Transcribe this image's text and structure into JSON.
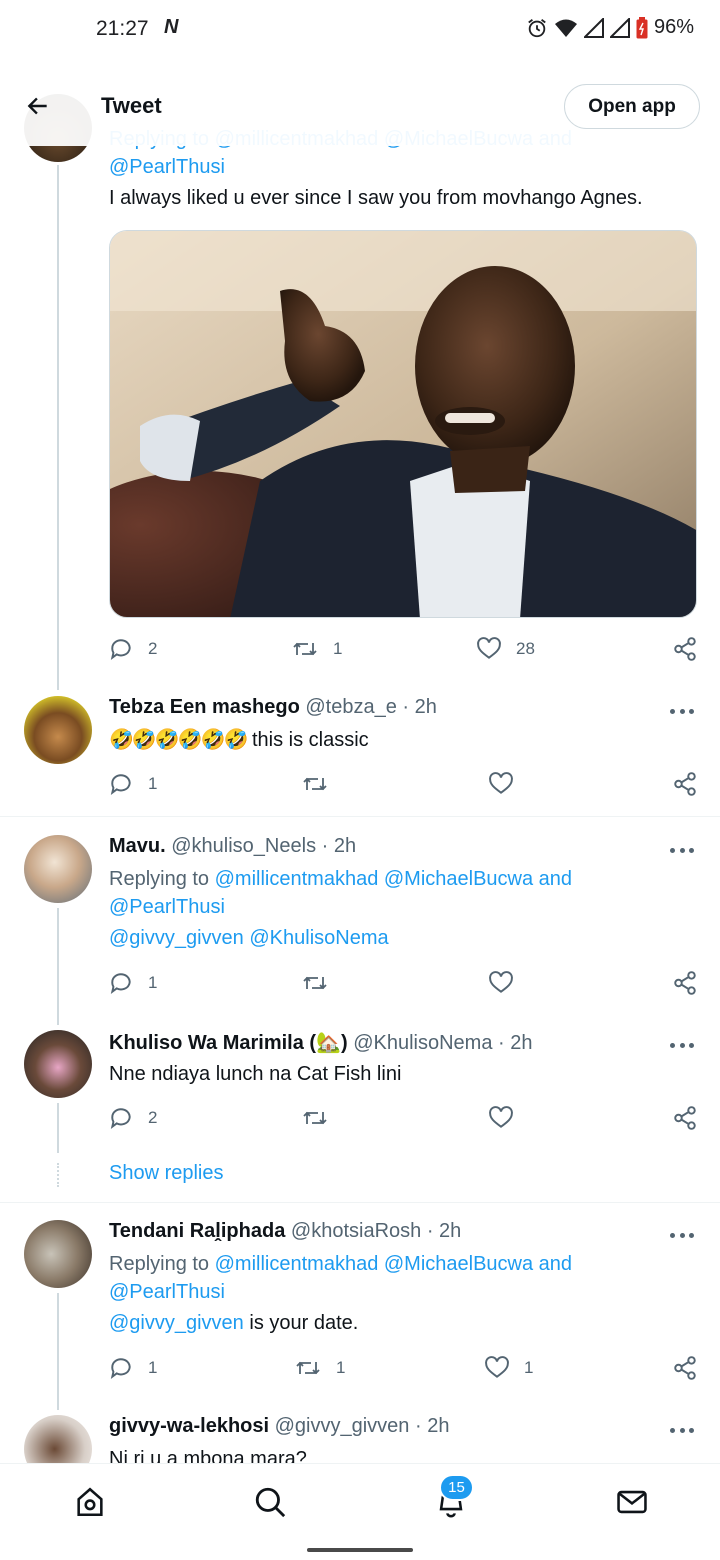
{
  "status_bar": {
    "time": "21:27",
    "net_label": "N",
    "battery": "96%"
  },
  "header": {
    "title": "Tweet",
    "open_app": "Open app"
  },
  "top_tweet": {
    "replying_partial": "Replying to @millicentmakhad @MichaelBucwa and",
    "mention_line": "@PearlThusi",
    "text": "I always liked u ever since I saw you from movhango Agnes.",
    "replies": "2",
    "retweets": "1",
    "likes": "28"
  },
  "replies": [
    {
      "name": "Tebza Een mashego",
      "handle": "@tebza_e",
      "time": "· 2h",
      "emojis": "🤣🤣🤣🤣🤣🤣",
      "text": "this is classic",
      "replies": "1",
      "retweets": "",
      "likes": ""
    },
    {
      "name": "Mavu.",
      "handle": "@khuliso_Neels",
      "time": "· 2h",
      "replying_to": "Replying to",
      "mentions_1": "@millicentmakhad @MichaelBucwa and",
      "mentions_2": "@PearlThusi",
      "text": "@givvy_givven @KhulisoNema",
      "replies": "1",
      "retweets": "",
      "likes": ""
    },
    {
      "name": "Khuliso Wa Marimila (",
      "name_emoji": "🏡",
      "name_end": ")",
      "handle": "@KhulisoNema",
      "time": "· 2h",
      "text": "Nne ndiaya lunch na Cat Fish lini",
      "replies": "2",
      "retweets": "",
      "likes": "",
      "show_replies": "Show replies"
    },
    {
      "name": "Tendani Raḽiphada",
      "handle": "@khotsiaRosh",
      "time": "· 2h",
      "replying_to": "Replying to",
      "mentions_1": "@millicentmakhad @MichaelBucwa and",
      "mentions_2": "@PearlThusi",
      "text_mention": "@givvy_givven",
      "text": " is your date.",
      "replies": "1",
      "retweets": "1",
      "likes": "1"
    },
    {
      "name": "givvy-wa-lekhosi",
      "handle": "@givvy_givven",
      "time": "· 2h",
      "text": "Ni ri u a mbona mara?"
    }
  ],
  "bottom_nav": {
    "notifications_badge": "15"
  },
  "colors": {
    "accent": "#1d9bf0",
    "muted": "#536471",
    "border": "#cfd9de"
  },
  "icons": [
    "back-arrow-icon",
    "reply-icon",
    "retweet-icon",
    "like-icon",
    "share-icon",
    "more-icon",
    "home-icon",
    "search-icon",
    "bell-icon",
    "mail-icon"
  ]
}
